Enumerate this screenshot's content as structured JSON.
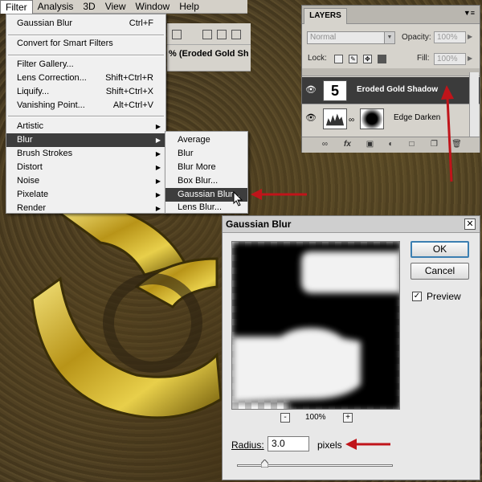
{
  "menubar": {
    "items": [
      "Filter",
      "Analysis",
      "3D",
      "View",
      "Window",
      "Help"
    ],
    "active": "Filter"
  },
  "filter_menu": {
    "last_filter": {
      "label": "Gaussian Blur",
      "shortcut": "Ctrl+F"
    },
    "smart": {
      "label": "Convert for Smart Filters"
    },
    "items1": [
      {
        "label": "Filter Gallery...",
        "shortcut": ""
      },
      {
        "label": "Lens Correction...",
        "shortcut": "Shift+Ctrl+R"
      },
      {
        "label": "Liquify...",
        "shortcut": "Shift+Ctrl+X"
      },
      {
        "label": "Vanishing Point...",
        "shortcut": "Alt+Ctrl+V"
      }
    ],
    "items2": [
      "Artistic",
      "Blur",
      "Brush Strokes",
      "Distort",
      "Noise",
      "Pixelate",
      "Render"
    ],
    "highlighted": "Blur"
  },
  "blur_submenu": {
    "items": [
      "Average",
      "Blur",
      "Blur More",
      "Box Blur...",
      "Gaussian Blur...",
      "Lens Blur..."
    ],
    "highlighted": "Gaussian Blur..."
  },
  "document": {
    "tab_label": "% (Eroded Gold Sh"
  },
  "layers": {
    "tab": "LAYERS",
    "blend_mode": "Normal",
    "opacity_label": "Opacity:",
    "opacity": "100%",
    "lock_label": "Lock:",
    "fill_label": "Fill:",
    "fill": "100%",
    "rows": [
      {
        "name": "Eroded Gold Shadow",
        "thumb_text": "5",
        "selected": true
      },
      {
        "name": "Edge Darken",
        "thumb_text": "",
        "selected": false
      }
    ]
  },
  "gaussian_dialog": {
    "title": "Gaussian Blur",
    "ok": "OK",
    "cancel": "Cancel",
    "preview_label": "Preview",
    "preview_checked": true,
    "zoom": "100%",
    "zoom_out": "-",
    "zoom_in": "+",
    "radius_label": "Radius:",
    "radius_value": "3.0",
    "radius_unit": "pixels",
    "radius_slider_fraction": 0.18
  },
  "colors": {
    "menu_highlight": "#3d3d3d",
    "arrow_red": "#c0141a",
    "gold": "#c9a62a"
  }
}
